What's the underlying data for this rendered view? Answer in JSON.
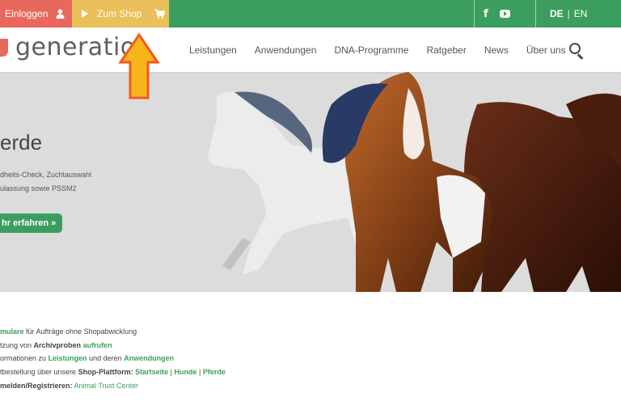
{
  "topbar": {
    "login_label": "Einloggen",
    "shop_label": "Zum Shop",
    "lang_de": "DE",
    "lang_sep": "|",
    "lang_en": "EN",
    "facebook_glyph": "f",
    "bg_color": "#3c9e5e",
    "login_color": "#e8685e",
    "shop_color": "#eac05a"
  },
  "header": {
    "logo_text": "generatio",
    "nav": [
      "Leistungen",
      "Anwendungen",
      "DNA-Programme",
      "Ratgeber",
      "News",
      "Über uns"
    ],
    "search_icon": "search-icon"
  },
  "hero": {
    "title": "erde",
    "line1": "dheits-Check, Zuchtauswahl",
    "line2": "ulassung sowie PSSM2",
    "button_label": "hr erfahren »"
  },
  "links": {
    "r1": {
      "a": "mulare",
      "b": " für Aufträge ohne Shopabwicklung"
    },
    "r2": {
      "a": "tzung von ",
      "b": "Archivproben",
      "c": " ",
      "d": "aufrufen"
    },
    "r3": {
      "a": "ormationen zu ",
      "b": "Leistungen",
      "c": " und deren ",
      "d": "Anwendungen"
    },
    "r4": {
      "a": "tbestellung über unsere ",
      "b": "Shop-Plattform:",
      "c": " ",
      "d": "Startseite",
      "e": " | ",
      "f": "Hunde",
      "g": " | ",
      "h": "Pferde"
    },
    "r5": {
      "a": "melden/Registrieren:",
      "b": " ",
      "c": "Animal Trust Center"
    }
  }
}
